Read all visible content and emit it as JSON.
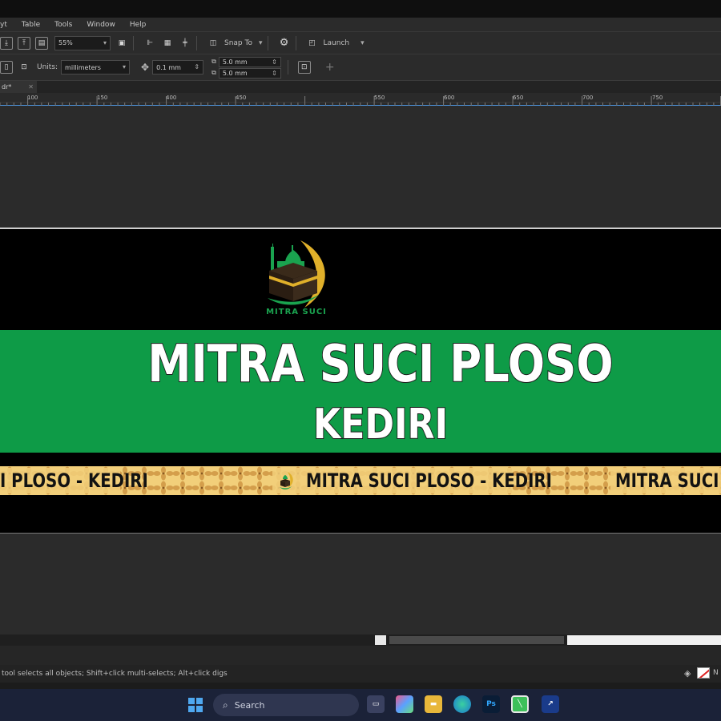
{
  "menu": [
    "yt",
    "Table",
    "Tools",
    "Window",
    "Help"
  ],
  "toolbar1": {
    "zoom_value": "55%",
    "snap_label": "Snap To",
    "launch_label": "Launch"
  },
  "toolbar2": {
    "units_label": "Units:",
    "units_value": "millimeters",
    "nudge_value": "0.1 mm",
    "dup_x_value": "5.0 mm",
    "dup_y_value": "5.0 mm",
    "add_label": "+"
  },
  "doc_tab": "dr*",
  "ruler_ticks": [
    "100",
    "150",
    "400",
    "450",
    "550",
    "600",
    "650",
    "700",
    "750"
  ],
  "banner": {
    "logo_text": "MITRA SUCI",
    "title_line1": "MITRA SUCI PLOSO",
    "title_line2": "KEDIRI",
    "strip_text_left": "I PLOSO - KEDIRI",
    "strip_text_center": "MITRA SUCI PLOSO - KEDIRI",
    "strip_text_right": "MITRA SUCI PL"
  },
  "status_text": "tool selects all objects; Shift+click multi-selects; Alt+click digs",
  "status_right": "N",
  "taskbar": {
    "search_placeholder": "Search",
    "ps_label": "Ps"
  },
  "colors": {
    "banner_green": "#0e9b47",
    "strip_gold": "#f2cf7a",
    "logo_green": "#1aa34f",
    "logo_gold": "#e0b02a"
  }
}
